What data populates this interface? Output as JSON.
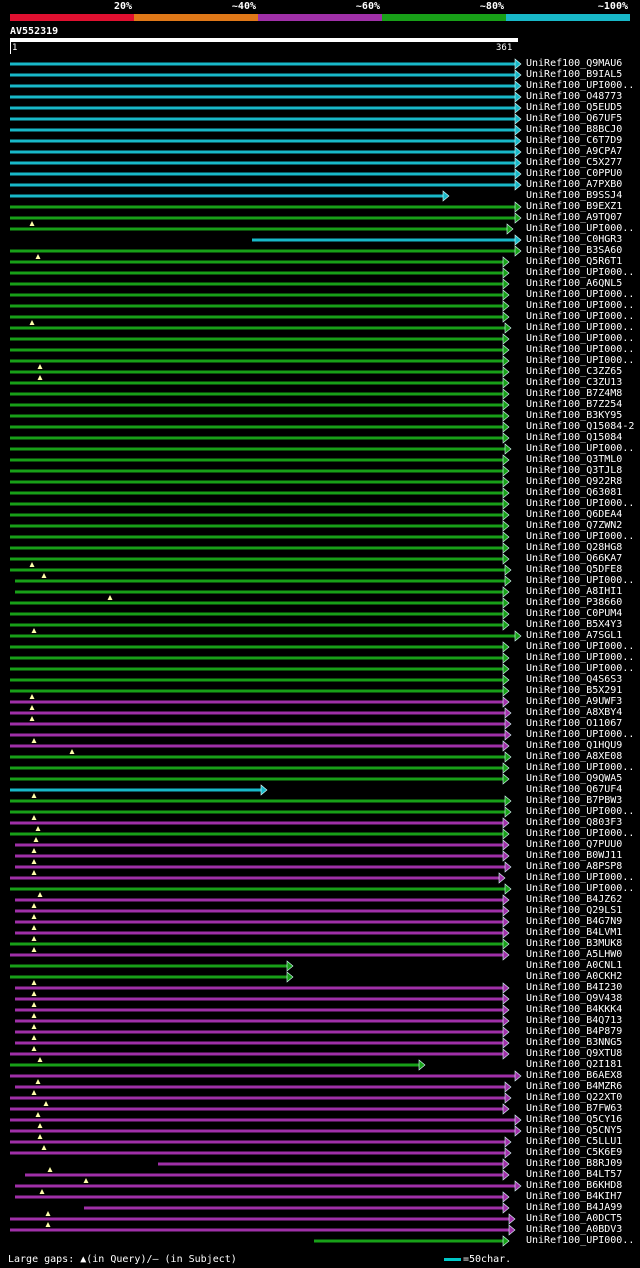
{
  "legend": {
    "labels": [
      "20%",
      "~40%",
      "~60%",
      "~80%",
      "~100%"
    ],
    "colors": [
      "#e01030",
      "#e07818",
      "#a030a8",
      "#18a018",
      "#18b8c8"
    ]
  },
  "query": {
    "name": "AV552319",
    "start": "1",
    "end": "361"
  },
  "palette": {
    "c": "#18b8c8",
    "g": "#18a018",
    "p": "#a030a8",
    "gap": "#ffffaa"
  },
  "hits": [
    {
      "l": "UniRef100_Q9MAU6",
      "c": "c",
      "s": 10,
      "e": 516
    },
    {
      "l": "UniRef100_B9IAL5",
      "c": "c",
      "s": 10,
      "e": 516
    },
    {
      "l": "UniRef100_UPI000..",
      "c": "c",
      "s": 10,
      "e": 516
    },
    {
      "l": "UniRef100_O48773",
      "c": "c",
      "s": 10,
      "e": 516
    },
    {
      "l": "UniRef100_Q5EUD5",
      "c": "c",
      "s": 10,
      "e": 516
    },
    {
      "l": "UniRef100_Q67UF5",
      "c": "c",
      "s": 10,
      "e": 516
    },
    {
      "l": "UniRef100_B8BCJ0",
      "c": "c",
      "s": 10,
      "e": 516
    },
    {
      "l": "UniRef100_C6T7D9",
      "c": "c",
      "s": 10,
      "e": 516
    },
    {
      "l": "UniRef100_A9CPA7",
      "c": "c",
      "s": 10,
      "e": 516
    },
    {
      "l": "UniRef100_C5X277",
      "c": "c",
      "s": 10,
      "e": 516
    },
    {
      "l": "UniRef100_C0PPU0",
      "c": "c",
      "s": 10,
      "e": 516
    },
    {
      "l": "UniRef100_A7PXB0",
      "c": "c",
      "s": 10,
      "e": 516
    },
    {
      "l": "UniRef100_B9SSJ4",
      "c": "c",
      "s": 10,
      "e": 444
    },
    {
      "l": "UniRef100_B9EXZ1",
      "c": "g",
      "s": 10,
      "e": 516
    },
    {
      "l": "UniRef100_A9TQ07",
      "c": "g",
      "s": 10,
      "e": 516
    },
    {
      "l": "UniRef100_UPI000..",
      "c": "g",
      "s": 10,
      "e": 508,
      "t": 32
    },
    {
      "l": "UniRef100_C0HGR3",
      "c": "c",
      "s": 252,
      "e": 516
    },
    {
      "l": "UniRef100_B3SA60",
      "c": "g",
      "s": 10,
      "e": 516
    },
    {
      "l": "UniRef100_Q5R6T1",
      "c": "g",
      "s": 10,
      "e": 504,
      "t": 38
    },
    {
      "l": "UniRef100_UPI000..",
      "c": "g",
      "s": 10,
      "e": 504
    },
    {
      "l": "UniRef100_A6QNL5",
      "c": "g",
      "s": 10,
      "e": 504
    },
    {
      "l": "UniRef100_UPI000..",
      "c": "g",
      "s": 10,
      "e": 504
    },
    {
      "l": "UniRef100_UPI000..",
      "c": "g",
      "s": 10,
      "e": 504
    },
    {
      "l": "UniRef100_UPI000..",
      "c": "g",
      "s": 10,
      "e": 504
    },
    {
      "l": "UniRef100_UPI000..",
      "c": "g",
      "s": 10,
      "e": 506,
      "t": 32
    },
    {
      "l": "UniRef100_UPI000..",
      "c": "g",
      "s": 10,
      "e": 504
    },
    {
      "l": "UniRef100_UPI000..",
      "c": "g",
      "s": 10,
      "e": 504
    },
    {
      "l": "UniRef100_UPI000..",
      "c": "g",
      "s": 10,
      "e": 504
    },
    {
      "l": "UniRef100_C3ZZ65",
      "c": "g",
      "s": 10,
      "e": 504,
      "t": 40
    },
    {
      "l": "UniRef100_C3ZU13",
      "c": "g",
      "s": 10,
      "e": 504,
      "t": 40
    },
    {
      "l": "UniRef100_B7Z4M8",
      "c": "g",
      "s": 10,
      "e": 504
    },
    {
      "l": "UniRef100_B7Z254",
      "c": "g",
      "s": 10,
      "e": 504
    },
    {
      "l": "UniRef100_B3KY95",
      "c": "g",
      "s": 10,
      "e": 504
    },
    {
      "l": "UniRef100_Q15084-2",
      "c": "g",
      "s": 10,
      "e": 504
    },
    {
      "l": "UniRef100_Q15084",
      "c": "g",
      "s": 10,
      "e": 504
    },
    {
      "l": "UniRef100_UPI000..",
      "c": "g",
      "s": 10,
      "e": 506
    },
    {
      "l": "UniRef100_Q3TML0",
      "c": "g",
      "s": 10,
      "e": 504
    },
    {
      "l": "UniRef100_Q3TJL8",
      "c": "g",
      "s": 10,
      "e": 504
    },
    {
      "l": "UniRef100_Q922R8",
      "c": "g",
      "s": 10,
      "e": 504
    },
    {
      "l": "UniRef100_Q63081",
      "c": "g",
      "s": 10,
      "e": 504
    },
    {
      "l": "UniRef100_UPI000..",
      "c": "g",
      "s": 10,
      "e": 504
    },
    {
      "l": "UniRef100_Q6DEA4",
      "c": "g",
      "s": 10,
      "e": 504
    },
    {
      "l": "UniRef100_Q7ZWN2",
      "c": "g",
      "s": 10,
      "e": 504
    },
    {
      "l": "UniRef100_UPI000..",
      "c": "g",
      "s": 10,
      "e": 504
    },
    {
      "l": "UniRef100_Q28HG8",
      "c": "g",
      "s": 10,
      "e": 504
    },
    {
      "l": "UniRef100_Q66KA7",
      "c": "g",
      "s": 10,
      "e": 504
    },
    {
      "l": "UniRef100_Q5DFE8",
      "c": "g",
      "s": 10,
      "e": 506,
      "t": 32
    },
    {
      "l": "UniRef100_UPI000..",
      "c": "g",
      "s": 15,
      "e": 506,
      "t": 44
    },
    {
      "l": "UniRef100_A8IHI1",
      "c": "g",
      "s": 15,
      "e": 504
    },
    {
      "l": "UniRef100_P38660",
      "c": "g",
      "s": 10,
      "e": 504,
      "t": 110
    },
    {
      "l": "UniRef100_C0PUM4",
      "c": "g",
      "s": 10,
      "e": 504
    },
    {
      "l": "UniRef100_B5X4Y3",
      "c": "g",
      "s": 10,
      "e": 504
    },
    {
      "l": "UniRef100_A7SGL1",
      "c": "g",
      "s": 10,
      "e": 516,
      "t": 34
    },
    {
      "l": "UniRef100_UPI000..",
      "c": "g",
      "s": 10,
      "e": 504
    },
    {
      "l": "UniRef100_UPI000..",
      "c": "g",
      "s": 10,
      "e": 504
    },
    {
      "l": "UniRef100_UPI000..",
      "c": "g",
      "s": 10,
      "e": 504
    },
    {
      "l": "UniRef100_Q4S6S3",
      "c": "g",
      "s": 10,
      "e": 504
    },
    {
      "l": "UniRef100_B5X291",
      "c": "g",
      "s": 10,
      "e": 504
    },
    {
      "l": "UniRef100_A9UWF3",
      "c": "p",
      "s": 10,
      "e": 504,
      "t": 32
    },
    {
      "l": "UniRef100_A8XBY4",
      "c": "p",
      "s": 10,
      "e": 506,
      "t": 32
    },
    {
      "l": "UniRef100_O11067",
      "c": "p",
      "s": 10,
      "e": 506,
      "t": 32
    },
    {
      "l": "UniRef100_UPI000..",
      "c": "p",
      "s": 10,
      "e": 506
    },
    {
      "l": "UniRef100_Q1HQU9",
      "c": "p",
      "s": 10,
      "e": 504,
      "t": 34
    },
    {
      "l": "UniRef100_A8XE08",
      "c": "g",
      "s": 10,
      "e": 506,
      "t": 72
    },
    {
      "l": "UniRef100_UPI000..",
      "c": "g",
      "s": 10,
      "e": 504
    },
    {
      "l": "UniRef100_Q9QWA5",
      "c": "g",
      "s": 10,
      "e": 504
    },
    {
      "l": "UniRef100_Q67UF4",
      "c": "c",
      "s": 10,
      "e": 262
    },
    {
      "l": "UniRef100_B7PBW3",
      "c": "g",
      "s": 10,
      "e": 506,
      "t": 34
    },
    {
      "l": "UniRef100_UPI000..",
      "c": "g",
      "s": 10,
      "e": 506
    },
    {
      "l": "UniRef100_Q803F3",
      "c": "p",
      "s": 10,
      "e": 504,
      "t": 34
    },
    {
      "l": "UniRef100_UPI000..",
      "c": "g",
      "s": 10,
      "e": 504,
      "t": 38
    },
    {
      "l": "UniRef100_Q7PUU0",
      "c": "p",
      "s": 15,
      "e": 504,
      "t": 36
    },
    {
      "l": "UniRef100_B0WJ11",
      "c": "p",
      "s": 15,
      "e": 504,
      "t": 34
    },
    {
      "l": "UniRef100_A8PSP8",
      "c": "p",
      "s": 15,
      "e": 506,
      "t": 34
    },
    {
      "l": "UniRef100_UPI000..",
      "c": "p",
      "s": 10,
      "e": 500,
      "t": 34
    },
    {
      "l": "UniRef100_UPI000..",
      "c": "g",
      "s": 10,
      "e": 506
    },
    {
      "l": "UniRef100_B4JZ62",
      "c": "p",
      "s": 15,
      "e": 504,
      "t": 40
    },
    {
      "l": "UniRef100_Q29LS1",
      "c": "p",
      "s": 15,
      "e": 504,
      "t": 34
    },
    {
      "l": "UniRef100_B4G7N9",
      "c": "p",
      "s": 15,
      "e": 504,
      "t": 34
    },
    {
      "l": "UniRef100_B4LVM1",
      "c": "p",
      "s": 15,
      "e": 504,
      "t": 34
    },
    {
      "l": "UniRef100_B3MUK8",
      "c": "g",
      "s": 10,
      "e": 504,
      "t": 34
    },
    {
      "l": "UniRef100_A5LHW0",
      "c": "p",
      "s": 10,
      "e": 504,
      "t": 34
    },
    {
      "l": "UniRef100_A0CNL1",
      "c": "g",
      "s": 10,
      "e": 288
    },
    {
      "l": "UniRef100_A0CKH2",
      "c": "g",
      "s": 10,
      "e": 288
    },
    {
      "l": "UniRef100_B4I230",
      "c": "p",
      "s": 15,
      "e": 504,
      "t": 34
    },
    {
      "l": "UniRef100_Q9V438",
      "c": "p",
      "s": 15,
      "e": 504,
      "t": 34
    },
    {
      "l": "UniRef100_B4KKK4",
      "c": "p",
      "s": 15,
      "e": 504,
      "t": 34
    },
    {
      "l": "UniRef100_B4Q713",
      "c": "p",
      "s": 15,
      "e": 504,
      "t": 34
    },
    {
      "l": "UniRef100_B4P879",
      "c": "p",
      "s": 15,
      "e": 504,
      "t": 34
    },
    {
      "l": "UniRef100_B3NNG5",
      "c": "p",
      "s": 15,
      "e": 504,
      "t": 34
    },
    {
      "l": "UniRef100_Q9XTU8",
      "c": "p",
      "s": 10,
      "e": 504,
      "t": 34
    },
    {
      "l": "UniRef100_Q2I181",
      "c": "g",
      "s": 10,
      "e": 420,
      "t": 40
    },
    {
      "l": "UniRef100_B6AEX8",
      "c": "p",
      "s": 10,
      "e": 516
    },
    {
      "l": "UniRef100_B4MZR6",
      "c": "p",
      "s": 15,
      "e": 506,
      "t": 38
    },
    {
      "l": "UniRef100_Q22XT0",
      "c": "p",
      "s": 10,
      "e": 506,
      "t": 34
    },
    {
      "l": "UniRef100_B7FW63",
      "c": "p",
      "s": 10,
      "e": 504,
      "t": 46
    },
    {
      "l": "UniRef100_Q5CY16",
      "c": "p",
      "s": 10,
      "e": 516,
      "t": 38
    },
    {
      "l": "UniRef100_Q5CNY5",
      "c": "p",
      "s": 10,
      "e": 516,
      "t": 40
    },
    {
      "l": "UniRef100_C5LLU1",
      "c": "p",
      "s": 10,
      "e": 506,
      "t": 40
    },
    {
      "l": "UniRef100_C5K6E9",
      "c": "p",
      "s": 10,
      "e": 506,
      "t": 44
    },
    {
      "l": "UniRef100_B8RJ09",
      "c": "p",
      "s": 158,
      "e": 504
    },
    {
      "l": "UniRef100_B4LT57",
      "c": "p",
      "s": 25,
      "e": 504,
      "t": 50
    },
    {
      "l": "UniRef100_B6KHD8",
      "c": "p",
      "s": 15,
      "e": 516,
      "t": 86
    },
    {
      "l": "UniRef100_B4KIH7",
      "c": "p",
      "s": 15,
      "e": 504,
      "t": 42
    },
    {
      "l": "UniRef100_B4JA99",
      "c": "p",
      "s": 84,
      "e": 504
    },
    {
      "l": "UniRef100_A0DCT5",
      "c": "p",
      "s": 10,
      "e": 510,
      "t": 48
    },
    {
      "l": "UniRef100_A0BDV3",
      "c": "p",
      "s": 10,
      "e": 510,
      "t": 48
    },
    {
      "l": "UniRef100_UPI000..",
      "c": "g",
      "s": 314,
      "e": 504
    }
  ],
  "footer": {
    "gaps_text": "Large gaps: ▲(in Query)/– (in Subject)",
    "scale_text": "=50char."
  }
}
